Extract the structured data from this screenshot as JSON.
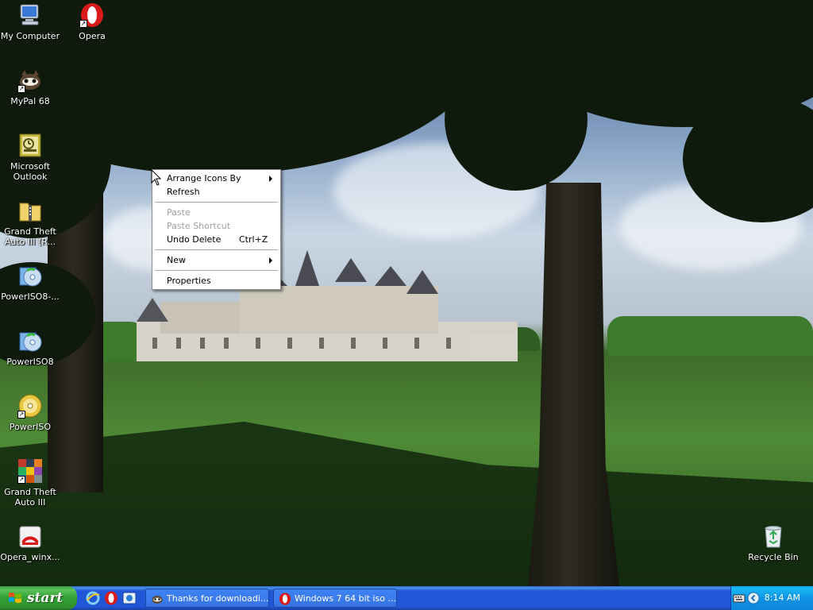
{
  "desktop_icons": [
    {
      "label": "My Computer",
      "icon": "computer-icon"
    },
    {
      "label": "Opera",
      "icon": "opera-icon"
    },
    {
      "label": "MyPal 68",
      "icon": "mypal-icon"
    },
    {
      "label": "Microsoft Outlook",
      "icon": "outlook-icon"
    },
    {
      "label": "Grand Theft Auto III (R...",
      "icon": "zip-folder-icon"
    },
    {
      "label": "PowerISO8-...",
      "icon": "poweriso-installer-icon"
    },
    {
      "label": "PowerISO8",
      "icon": "poweriso-installer-icon"
    },
    {
      "label": "PowerISO",
      "icon": "poweriso-disc-icon"
    },
    {
      "label": "Grand Theft Auto III",
      "icon": "gta3-icon"
    },
    {
      "label": "Opera_winx...",
      "icon": "opera-installer-icon"
    },
    {
      "label": "Recycle Bin",
      "icon": "recycle-bin-icon"
    }
  ],
  "context_menu": {
    "items": [
      {
        "label": "Arrange Icons By",
        "submenu": true,
        "disabled": false,
        "shortcut": ""
      },
      {
        "label": "Refresh",
        "submenu": false,
        "disabled": false,
        "shortcut": ""
      },
      {
        "label": "Paste",
        "submenu": false,
        "disabled": true,
        "shortcut": ""
      },
      {
        "label": "Paste Shortcut",
        "submenu": false,
        "disabled": true,
        "shortcut": ""
      },
      {
        "label": "Undo Delete",
        "submenu": false,
        "disabled": false,
        "shortcut": "Ctrl+Z"
      },
      {
        "label": "New",
        "submenu": true,
        "disabled": false,
        "shortcut": ""
      },
      {
        "label": "Properties",
        "submenu": false,
        "disabled": false,
        "shortcut": ""
      }
    ]
  },
  "taskbar": {
    "start_label": "start",
    "tasks": [
      {
        "label": "Thanks for downloadi...",
        "icon": "mypal-icon"
      },
      {
        "label": "Windows 7 64 bit iso ...",
        "icon": "opera-icon"
      }
    ],
    "clock": "8:14 AM"
  },
  "colors": {
    "taskbar_blue": "#2157d7",
    "start_green": "#35a235",
    "tray_blue": "#0f92e5"
  }
}
